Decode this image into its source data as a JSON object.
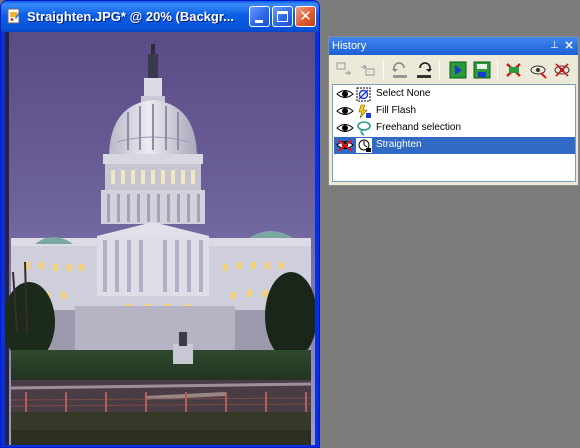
{
  "document_window": {
    "title": "Straighten.JPG* @  20% (Backgr...",
    "minimize_glyph": "_",
    "maximize_glyph": "□",
    "close_glyph": "✕",
    "icon": "paint-document-icon"
  },
  "history_palette": {
    "title": "History",
    "pin_glyph": "⊥",
    "close_glyph": "×",
    "toolbar": [
      {
        "name": "undo-to-selected-button",
        "icon": "undo-to-icon"
      },
      {
        "name": "redo-to-selected-button",
        "icon": "redo-to-icon"
      },
      {
        "name": "undo-button",
        "icon": "undo-icon"
      },
      {
        "name": "redo-button",
        "icon": "redo-icon"
      },
      {
        "name": "quickscript-play-button",
        "icon": "quickscript-play-icon"
      },
      {
        "name": "save-quickscript-button",
        "icon": "save-quickscript-icon"
      },
      {
        "name": "clear-history-button",
        "icon": "clear-history-icon"
      },
      {
        "name": "empty-command-history-button",
        "icon": "empty-command-icon"
      },
      {
        "name": "delete-history-button",
        "icon": "delete-history-icon"
      }
    ],
    "items": [
      {
        "label": "Select None",
        "icon": "select-none-icon",
        "visible": true,
        "selected": false
      },
      {
        "label": "Fill Flash",
        "icon": "fill-flash-icon",
        "visible": true,
        "selected": false
      },
      {
        "label": "Freehand selection",
        "icon": "freehand-selection-icon",
        "visible": true,
        "selected": false
      },
      {
        "label": "Straighten",
        "icon": "straighten-icon",
        "visible": false,
        "selected": true
      }
    ]
  },
  "colors": {
    "xp_blue": "#0a5fe6",
    "selection": "#316ac5",
    "workspace": "#7b7b7b",
    "palette_bg": "#ece9d8"
  }
}
